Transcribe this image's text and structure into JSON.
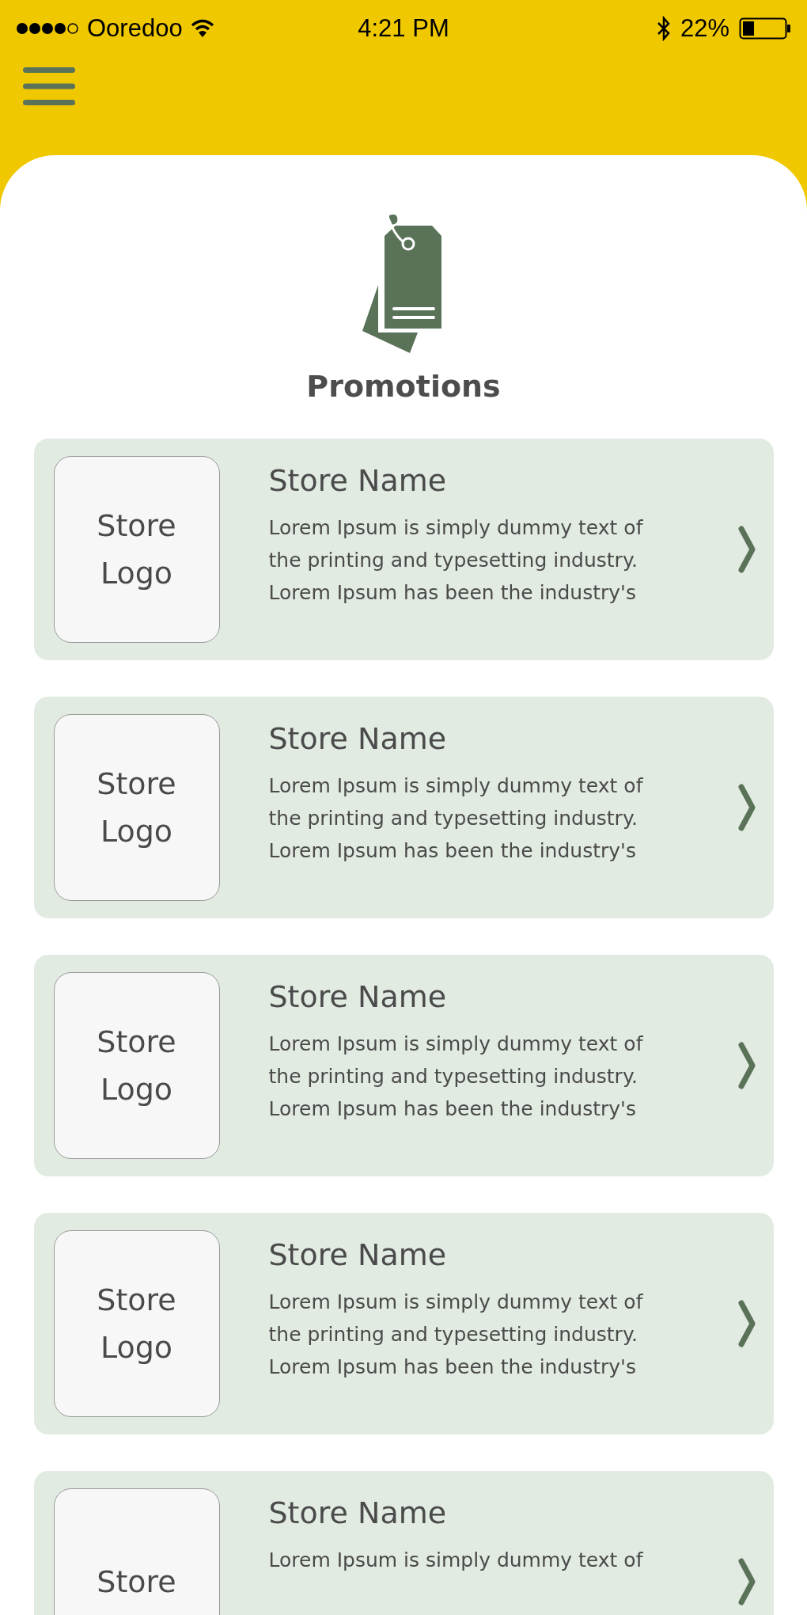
{
  "status_bar": {
    "carrier": "Ooredoo",
    "time": "4:21 PM",
    "battery": "22%"
  },
  "page": {
    "title": "Promotions"
  },
  "stores": [
    {
      "logo_text": [
        "Store",
        "Logo"
      ],
      "name": "Store Name",
      "description_lines": [
        "Lorem Ipsum is simply dummy text of",
        "the printing and typesetting industry.",
        "Lorem Ipsum has been the industry's"
      ]
    },
    {
      "logo_text": [
        "Store",
        "Logo"
      ],
      "name": "Store Name",
      "description_lines": [
        "Lorem Ipsum is simply dummy text of",
        "the printing and typesetting industry.",
        "Lorem Ipsum has been the industry's"
      ]
    },
    {
      "logo_text": [
        "Store",
        "Logo"
      ],
      "name": "Store Name",
      "description_lines": [
        "Lorem Ipsum is simply dummy text of",
        "the printing and typesetting industry.",
        "Lorem Ipsum has been the industry's"
      ]
    },
    {
      "logo_text": [
        "Store",
        "Logo"
      ],
      "name": "Store Name",
      "description_lines": [
        "Lorem Ipsum is simply dummy text of",
        "the printing and typesetting industry.",
        "Lorem Ipsum has been the industry's"
      ]
    },
    {
      "logo_text": [
        "Store"
      ],
      "name": "Store Name",
      "description_lines": [
        "Lorem Ipsum is simply dummy text of"
      ]
    }
  ]
}
